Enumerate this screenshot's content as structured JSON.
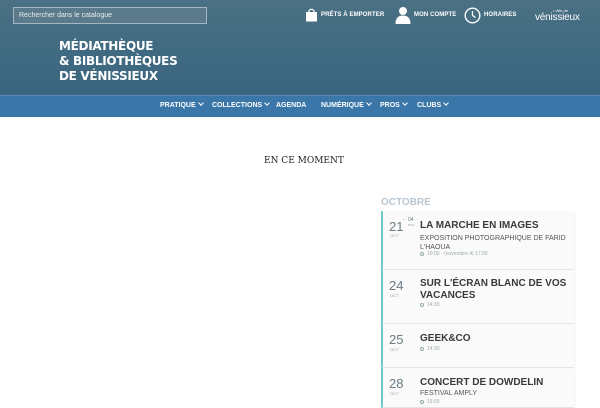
{
  "header": {
    "search_placeholder": "Rechercher dans le catalogue",
    "links": {
      "prets": "PRÊTS À EMPORTER",
      "compte": "MON COMPTE",
      "horaires": "HORAIRES"
    },
    "brand_small": "• ville de",
    "brand_big": "vénissieux",
    "title_line1": "MÉDIATHÈQUE",
    "title_line2": "& BIBLIOTHÈQUES",
    "title_line3": "DE VÉNISSIEUX"
  },
  "nav": {
    "items": [
      {
        "label": "PRATIQUE"
      },
      {
        "label": "COLLECTIONS"
      },
      {
        "label": "AGENDA"
      },
      {
        "label": "NUMÉRIQUE"
      },
      {
        "label": "PROS"
      },
      {
        "label": "CLUBS"
      }
    ]
  },
  "main": {
    "section_title": "EN CE MOMENT",
    "month": "OCTOBRE",
    "events": [
      {
        "day": "21",
        "mon": "OCT",
        "end_day": "04",
        "end_mon": "NOV",
        "title": "LA MARCHE EN IMAGES",
        "sub": "EXPOSITION PHOTOGRAPHIQUE DE FARID L'HAOUA",
        "time": "10:00 - (novembre 4) 17:00"
      },
      {
        "day": "24",
        "mon": "OCT",
        "title": "SUR L'ÉCRAN BLANC DE VOS VACANCES",
        "time": "14:30"
      },
      {
        "day": "25",
        "mon": "OCT",
        "title": "GEEK&CO",
        "time": "14:30"
      },
      {
        "day": "28",
        "mon": "OCT",
        "title": "CONCERT DE DOWDELIN",
        "sub": "FESTIVAL AMPLY",
        "time": "15:00"
      }
    ]
  }
}
